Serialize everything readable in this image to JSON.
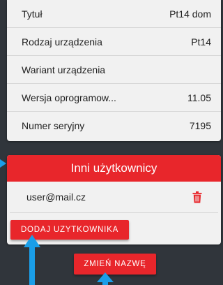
{
  "device_info": {
    "rows": [
      {
        "label": "Tytuł",
        "value": "Pt14 dom"
      },
      {
        "label": "Rodzaj urządzenia",
        "value": "Pt14"
      },
      {
        "label": "Wariant urządzenia",
        "value": ""
      },
      {
        "label": "Wersja oprogramow...",
        "value": "11.05"
      },
      {
        "label": "Numer seryjny",
        "value": "7195"
      }
    ]
  },
  "users_panel": {
    "title": "Inni użytkownicy",
    "users": [
      {
        "email": "user@mail.cz",
        "action_icon": "trash-icon"
      }
    ]
  },
  "buttons": {
    "add_user": "DODAJ UZYTKOWNIKA",
    "rename": "ZMIEŃ NAZWĘ"
  },
  "colors": {
    "background": "#30353b",
    "accent": "#e8262b",
    "annotation_arrow": "#1a9ee8"
  }
}
